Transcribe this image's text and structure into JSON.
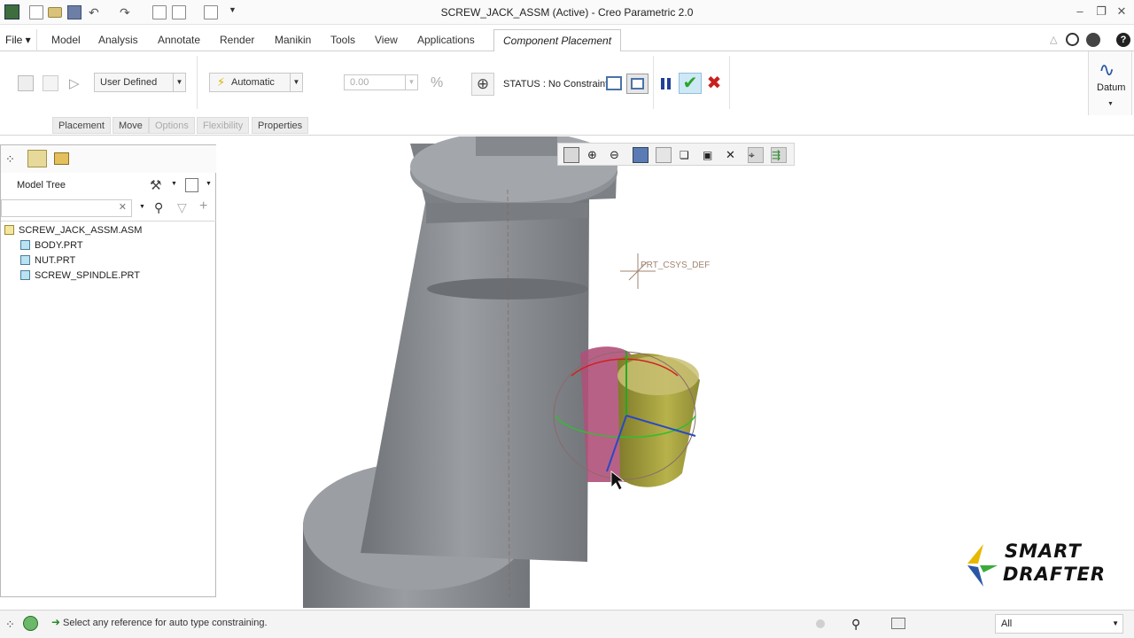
{
  "window": {
    "title": "SCREW_JACK_ASSM (Active) - Creo Parametric 2.0",
    "controls": [
      "minimize-icon",
      "restore-icon",
      "close-icon"
    ]
  },
  "quick_access": [
    "new-icon",
    "open-icon",
    "save-icon",
    "undo-icon",
    "redo-icon",
    "regenerate-icon",
    "windows-icon",
    "close-window-icon",
    "customize-icon"
  ],
  "menu": {
    "file": "File",
    "tabs": [
      "Model",
      "Analysis",
      "Annotate",
      "Render",
      "Manikin",
      "Tools",
      "View",
      "Applications"
    ],
    "active_tab": "Component Placement"
  },
  "ribbon": {
    "constraint_set": "User Defined",
    "constraint_type": "Automatic",
    "offset_value": "0.00",
    "status_text": "STATUS : No Constraints",
    "datum_label": "Datum",
    "subtabs": [
      {
        "label": "Placement",
        "enabled": true
      },
      {
        "label": "Move",
        "enabled": true
      },
      {
        "label": "Options",
        "enabled": false
      },
      {
        "label": "Flexibility",
        "enabled": false
      },
      {
        "label": "Properties",
        "enabled": true
      }
    ]
  },
  "model_tree": {
    "title": "Model Tree",
    "items": [
      {
        "label": "SCREW_JACK_ASSM.ASM",
        "type": "assembly"
      },
      {
        "label": "BODY.PRT",
        "type": "part"
      },
      {
        "label": "NUT.PRT",
        "type": "part"
      },
      {
        "label": "SCREW_SPINDLE.PRT",
        "type": "part"
      }
    ]
  },
  "graphics": {
    "csys_label": "PRT_CSYS_DEF",
    "logo_line1": "SMART",
    "logo_line2": "DRAFTER"
  },
  "statusbar": {
    "message": "Select any reference for auto type constraining.",
    "filter": "All"
  },
  "colors": {
    "accept": "#2aa52a",
    "cancel": "#c8201e",
    "pause": "#1f3f9a",
    "body_gray": "#8c8f94",
    "nut_yellow": "#a8a23c",
    "spindle_magenta": "#b0507a"
  }
}
